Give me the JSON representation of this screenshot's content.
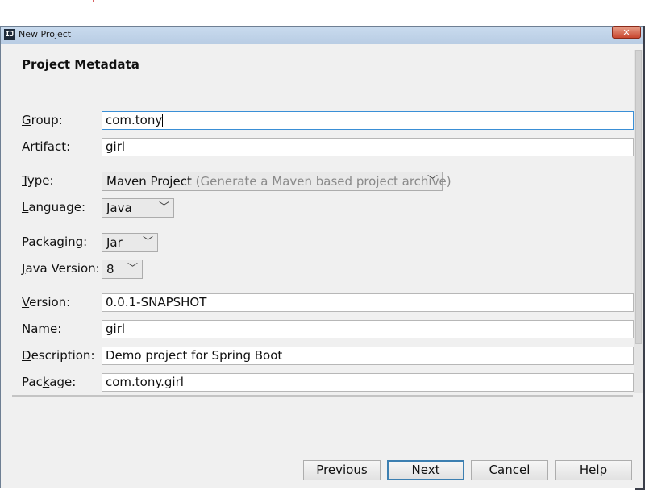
{
  "window": {
    "title": "New Project",
    "close_glyph": "✕",
    "app_icon_text": "IJ"
  },
  "section_title": "Project Metadata",
  "fields": {
    "group": {
      "mnemonic": "G",
      "rest": "roup:",
      "value": "com.tony"
    },
    "artifact": {
      "mnemonic": "A",
      "rest": "rtifact:",
      "value": "girl"
    },
    "type": {
      "mnemonic": "T",
      "rest": "ype:",
      "value": "Maven Project",
      "hint": "(Generate a Maven based project archive)"
    },
    "language": {
      "mnemonic": "L",
      "rest": "anguage:",
      "value": "Java"
    },
    "packaging": {
      "label": "Packaging:",
      "value": "Jar"
    },
    "java_version": {
      "mnemonic": "J",
      "rest": "ava Version:",
      "value": "8"
    },
    "version": {
      "mnemonic": "V",
      "rest": "ersion:",
      "value": "0.0.1-SNAPSHOT"
    },
    "name": {
      "pre": "Na",
      "mnemonic": "m",
      "rest": "e:",
      "value": "girl"
    },
    "description": {
      "mnemonic": "D",
      "rest": "escription:",
      "value": "Demo project for Spring Boot"
    },
    "package": {
      "pre": "Pac",
      "mnemonic": "k",
      "rest": "age:",
      "value": "com.tony.girl"
    }
  },
  "buttons": {
    "previous": "Previous",
    "next": "Next",
    "cancel": "Cancel",
    "help": "Help"
  },
  "colors": {
    "focus_border": "#3a8fd6",
    "default_button_border": "#3c7fb1",
    "close_button": "#c8462f"
  }
}
